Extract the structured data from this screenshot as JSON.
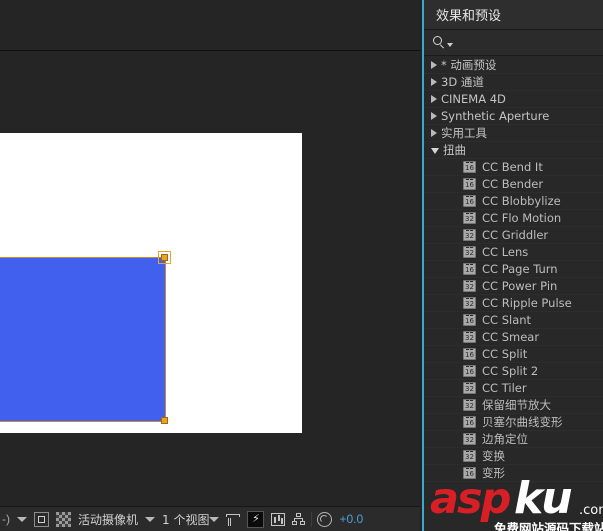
{
  "viewer": {
    "name": "composition-viewer",
    "canvas": {
      "background_color": "#ffffff",
      "stage_color": "#252525"
    },
    "layer": {
      "name": "blue-solid-layer",
      "fill_color": "#4260ee",
      "selection_color": "#f0a11e",
      "outline_color": "#c98a2a"
    }
  },
  "bottombar": {
    "magnification_label": "-)",
    "magnification_caret": "caret-down-icon",
    "toggle_mask_label": "region-of-interest-icon",
    "transparency_grid_label": "transparency-grid-icon",
    "camera_view": "活动摄像机",
    "camera_caret": "caret-down-icon",
    "view_count": "1 个视图",
    "view_caret": "caret-down-icon",
    "snapping_label": "snapping-icon",
    "fast_preview_label": "⚡",
    "timeline_label": "timeline-icon",
    "flowchart_label": "flowchart-icon",
    "shutter_label": "shutter-icon",
    "exposure_value": "+0.0"
  },
  "fx_panel": {
    "title": "效果和预设",
    "search": {
      "icon": "search-icon",
      "placeholder": "",
      "value": ""
    },
    "groups": [
      {
        "label": "* 动画预设",
        "expanded": false
      },
      {
        "label": "3D 通道",
        "expanded": false
      },
      {
        "label": "CINEMA 4D",
        "expanded": false
      },
      {
        "label": "Synthetic Aperture",
        "expanded": false
      },
      {
        "label": "实用工具",
        "expanded": false
      },
      {
        "label": "扭曲",
        "expanded": true
      }
    ],
    "effects": [
      {
        "label": "CC Bend It",
        "depth": "16"
      },
      {
        "label": "CC Bender",
        "depth": "16"
      },
      {
        "label": "CC Blobbylize",
        "depth": "16"
      },
      {
        "label": "CC Flo Motion",
        "depth": "32"
      },
      {
        "label": "CC Griddler",
        "depth": "32"
      },
      {
        "label": "CC Lens",
        "depth": "32"
      },
      {
        "label": "CC Page Turn",
        "depth": "16"
      },
      {
        "label": "CC Power Pin",
        "depth": "32"
      },
      {
        "label": "CC Ripple Pulse",
        "depth": "32"
      },
      {
        "label": "CC Slant",
        "depth": "16"
      },
      {
        "label": "CC Smear",
        "depth": "32"
      },
      {
        "label": "CC Split",
        "depth": "16"
      },
      {
        "label": "CC Split 2",
        "depth": "16"
      },
      {
        "label": "CC Tiler",
        "depth": "32"
      },
      {
        "label": "保留细节放大",
        "depth": "32"
      },
      {
        "label": "贝塞尔曲线变形",
        "depth": "16"
      },
      {
        "label": "边角定位",
        "depth": "32"
      },
      {
        "label": "变换",
        "depth": "32"
      },
      {
        "label": "变形",
        "depth": "16"
      }
    ]
  },
  "watermark": {
    "brand_red": "asp",
    "brand_white": "ku",
    "domain": ".com",
    "subtitle": "免费网站源码下载站!",
    "red_color": "#d81f26"
  }
}
